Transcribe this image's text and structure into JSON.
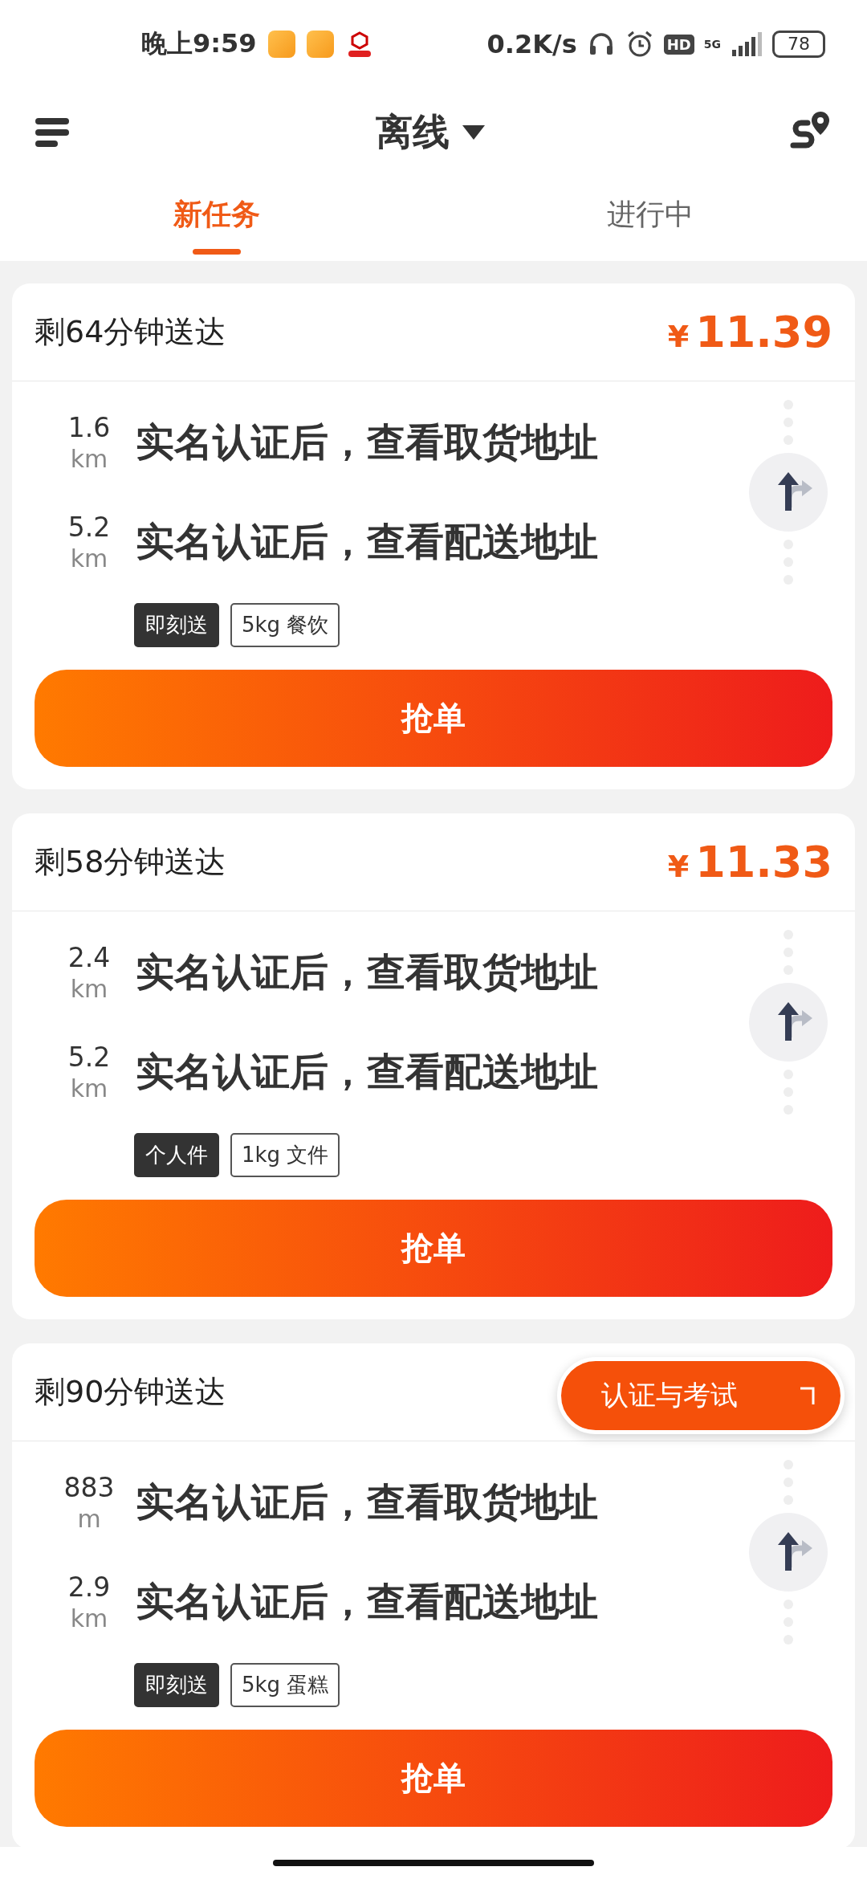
{
  "status_bar": {
    "time": "晚上9:59",
    "net_speed": "0.2K/s",
    "hd": "HD",
    "network": "5G",
    "battery": "78"
  },
  "header": {
    "title": "离线"
  },
  "tabs": [
    {
      "label": "新任务",
      "selected": true
    },
    {
      "label": "进行中",
      "selected": false
    }
  ],
  "orders": [
    {
      "eta": "剩64分钟送达",
      "price_symbol": "¥",
      "price": "11.39",
      "stops": [
        {
          "distance": "1.6",
          "unit": "km",
          "address": "实名认证后，查看取货地址"
        },
        {
          "distance": "5.2",
          "unit": "km",
          "address": "实名认证后，查看配送地址"
        }
      ],
      "tags": [
        {
          "label": "即刻送",
          "kind": "filled"
        },
        {
          "label": "5kg 餐饮",
          "kind": "outline"
        }
      ],
      "action": "抢单"
    },
    {
      "eta": "剩58分钟送达",
      "price_symbol": "¥",
      "price": "11.33",
      "stops": [
        {
          "distance": "2.4",
          "unit": "km",
          "address": "实名认证后，查看取货地址"
        },
        {
          "distance": "5.2",
          "unit": "km",
          "address": "实名认证后，查看配送地址"
        }
      ],
      "tags": [
        {
          "label": "个人件",
          "kind": "filled"
        },
        {
          "label": "1kg 文件",
          "kind": "outline"
        }
      ],
      "action": "抢单"
    },
    {
      "eta": "剩90分钟送达",
      "stops": [
        {
          "distance": "883",
          "unit": "m",
          "address": "实名认证后，查看取货地址"
        },
        {
          "distance": "2.9",
          "unit": "km",
          "address": "实名认证后，查看配送地址"
        }
      ],
      "tags": [
        {
          "label": "即刻送",
          "kind": "filled"
        },
        {
          "label": "5kg 蛋糕",
          "kind": "outline"
        }
      ],
      "action": "抢单"
    }
  ],
  "floating_button": {
    "label": "认证与考试"
  }
}
